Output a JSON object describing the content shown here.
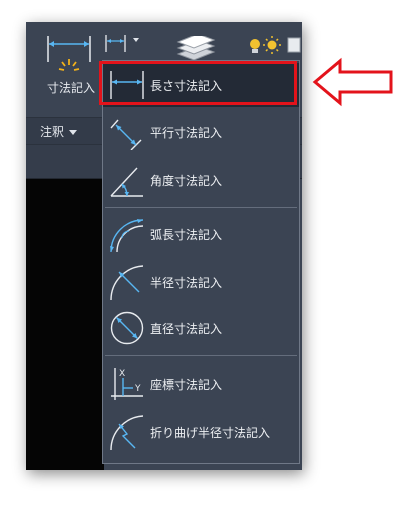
{
  "ribbon": {
    "dimension_button_label": "寸法記入",
    "annotation_panel_label": "注釈"
  },
  "dimension_menu": {
    "items": [
      {
        "label": "長さ寸法記入",
        "icon": "linear-dimension-icon",
        "selected": true
      },
      {
        "label": "平行寸法記入",
        "icon": "aligned-dimension-icon"
      },
      {
        "label": "角度寸法記入",
        "icon": "angular-dimension-icon"
      },
      {
        "label": "弧長寸法記入",
        "icon": "arc-length-dimension-icon"
      },
      {
        "label": "半径寸法記入",
        "icon": "radius-dimension-icon"
      },
      {
        "label": "直径寸法記入",
        "icon": "diameter-dimension-icon"
      },
      {
        "label": "座標寸法記入",
        "icon": "ordinate-dimension-icon"
      },
      {
        "label": "折り曲げ半径寸法記入",
        "icon": "jogged-radius-dimension-icon"
      }
    ]
  },
  "colors": {
    "panel_bg": "#3b4453",
    "selected_row_bg": "#232a36",
    "icon_blue": "#58b6f2",
    "icon_white": "#e8ebef",
    "highlight_red": "#e3131b"
  }
}
